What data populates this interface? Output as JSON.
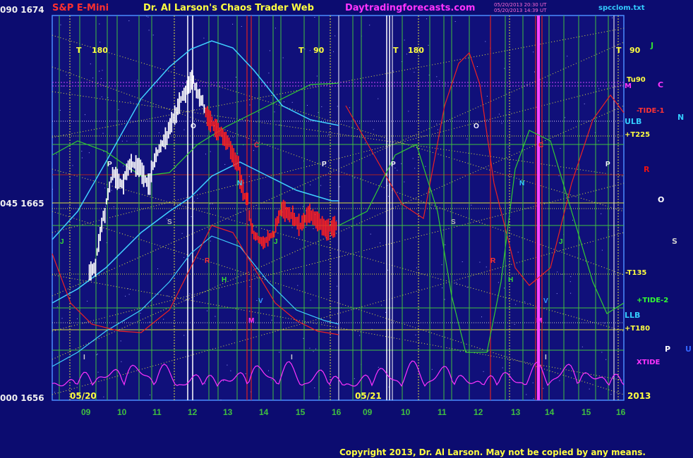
{
  "header": {
    "title": "S&P E-Mini",
    "brand": "Dr. Al Larson's Chaos Trader Web",
    "site": "Daytradingforecasts.com",
    "timestamp1": "05/20/2013 20:30 UT",
    "timestamp2": "05/20/2013 14:39 UT",
    "file": "spcclom.txt"
  },
  "copyright": "Copyright 2013, Dr. Al Larson. May not be copied by any means.",
  "year": "2013",
  "y_labels": [
    {
      "text": "090  1674",
      "value": 1674
    },
    {
      "text": "045  1665",
      "value": 1665
    },
    {
      "text": "000  1656",
      "value": 1656
    }
  ],
  "dates": [
    "05/20",
    "05/21"
  ],
  "right_labels": [
    {
      "text": "J",
      "color": "#33dd33"
    },
    {
      "text": "Tu90",
      "color": "#ffff40"
    },
    {
      "text": "M",
      "color": "#ff33ff"
    },
    {
      "text": "C",
      "color": "#ff33ff"
    },
    {
      "text": "-TIDE-1",
      "color": "#ff3333"
    },
    {
      "text": "N",
      "color": "#33ccff"
    },
    {
      "text": "ULB",
      "color": "#33ccff"
    },
    {
      "text": "+T225",
      "color": "#ffff40"
    },
    {
      "text": "R",
      "color": "#ee1111"
    },
    {
      "text": "O",
      "color": "#ffffff"
    },
    {
      "text": "S",
      "color": "#cccccc"
    },
    {
      "text": "-T135",
      "color": "#ffff40"
    },
    {
      "text": "+TIDE-2",
      "color": "#33ff33"
    },
    {
      "text": "LLB",
      "color": "#33ccff"
    },
    {
      "text": "+T180",
      "color": "#ffff40"
    },
    {
      "text": "P",
      "color": "#ffffff"
    },
    {
      "text": "U",
      "color": "#3366ff"
    },
    {
      "text": "XTIDE",
      "color": "#ff33ff"
    }
  ],
  "cycle_labels": [
    "T",
    "180",
    "T",
    "90",
    "T",
    "180",
    "T",
    "90"
  ],
  "planet_markers": [
    "P",
    "O",
    "S",
    "C",
    "N",
    "H",
    "R",
    "M",
    "J",
    "V",
    "U",
    "I"
  ],
  "colors": {
    "background": "#0c0c70",
    "plot_border": "#4a8cff",
    "grid_yellow": "#e0e040",
    "grid_green": "#40c040",
    "upper_band": "#40d0ff",
    "tide1": "#ee2222",
    "tide2": "#33cc33",
    "xtide": "#ff33ff",
    "bars_day1": "#ffffff",
    "bars_day2": "#ff2020",
    "title_red": "#ff3030",
    "brand_yellow": "#ffff40",
    "site_magenta": "#ff33ff"
  },
  "chart_data": {
    "type": "line",
    "title": "S&P E-Mini",
    "xlabel": "",
    "ylabel": "",
    "ylim": [
      1656,
      1674
    ],
    "x_ticks": [
      "09",
      "10",
      "11",
      "12",
      "13",
      "14",
      "15",
      "16",
      "09",
      "10",
      "11",
      "12",
      "13",
      "14",
      "15",
      "16"
    ],
    "price_series": [
      {
        "hour": 8.25,
        "value": 1662.0
      },
      {
        "hour": 8.5,
        "value": 1661.7
      },
      {
        "hour": 8.75,
        "value": 1661.4
      },
      {
        "hour": 9.0,
        "value": 1661.6
      },
      {
        "hour": 9.25,
        "value": 1662.0
      },
      {
        "hour": 9.5,
        "value": 1664.5
      },
      {
        "hour": 9.75,
        "value": 1666.5
      },
      {
        "hour": 10.0,
        "value": 1666.0
      },
      {
        "hour": 10.25,
        "value": 1667.0
      },
      {
        "hour": 10.5,
        "value": 1666.8
      },
      {
        "hour": 10.75,
        "value": 1666.0
      },
      {
        "hour": 11.0,
        "value": 1667.5
      },
      {
        "hour": 11.25,
        "value": 1668.2
      },
      {
        "hour": 11.5,
        "value": 1669.3
      },
      {
        "hour": 11.75,
        "value": 1670.3
      },
      {
        "hour": 12.0,
        "value": 1671.0
      },
      {
        "hour": 12.25,
        "value": 1670.0
      },
      {
        "hour": 12.5,
        "value": 1669.0
      },
      {
        "hour": 12.75,
        "value": 1668.5
      },
      {
        "hour": 13.0,
        "value": 1668.0
      },
      {
        "hour": 13.25,
        "value": 1667.0
      },
      {
        "hour": 13.5,
        "value": 1665.3
      },
      {
        "hour": 13.75,
        "value": 1663.5
      },
      {
        "hour": 14.0,
        "value": 1663.2
      },
      {
        "hour": 14.25,
        "value": 1663.6
      },
      {
        "hour": 14.5,
        "value": 1664.8
      },
      {
        "hour": 14.75,
        "value": 1664.5
      },
      {
        "hour": 15.0,
        "value": 1664.0
      },
      {
        "hour": 15.25,
        "value": 1664.6
      },
      {
        "hour": 15.5,
        "value": 1664.2
      },
      {
        "hour": 15.75,
        "value": 1663.8
      },
      {
        "hour": 16.0,
        "value": 1664.0
      }
    ]
  }
}
